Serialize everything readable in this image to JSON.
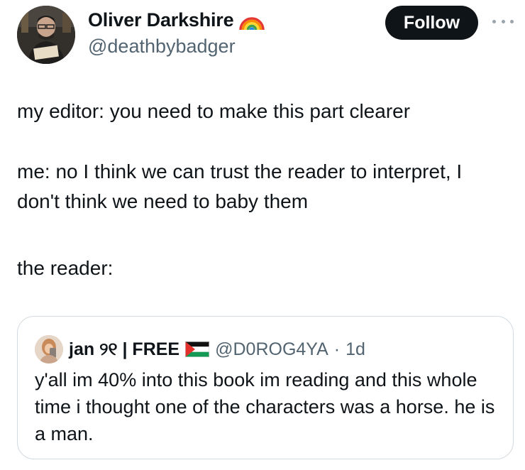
{
  "author": {
    "display_name": "Oliver Darkshire",
    "handle": "@deathbybadger",
    "badge_icon": "rainbow-icon"
  },
  "follow_label": "Follow",
  "more_icon": "more-dots-icon",
  "tweet": {
    "paragraphs": [
      "my editor: you need to make this part clearer",
      "me: no I think we can trust the reader to interpret, I don't think we need to baby them",
      "the reader:"
    ]
  },
  "quote": {
    "name": "jan ୨୧ | FREE",
    "flag_icon": "palestine-flag-icon",
    "handle": "@D0ROG4YA",
    "separator": "·",
    "time": "1d",
    "text": "y'all im 40% into this book im reading and this whole time i thought one of the characters was a horse. he is a man."
  },
  "colors": {
    "text": "#0f1419",
    "secondary": "#536471",
    "button_bg": "#0f1419",
    "border": "#d3dae0"
  }
}
